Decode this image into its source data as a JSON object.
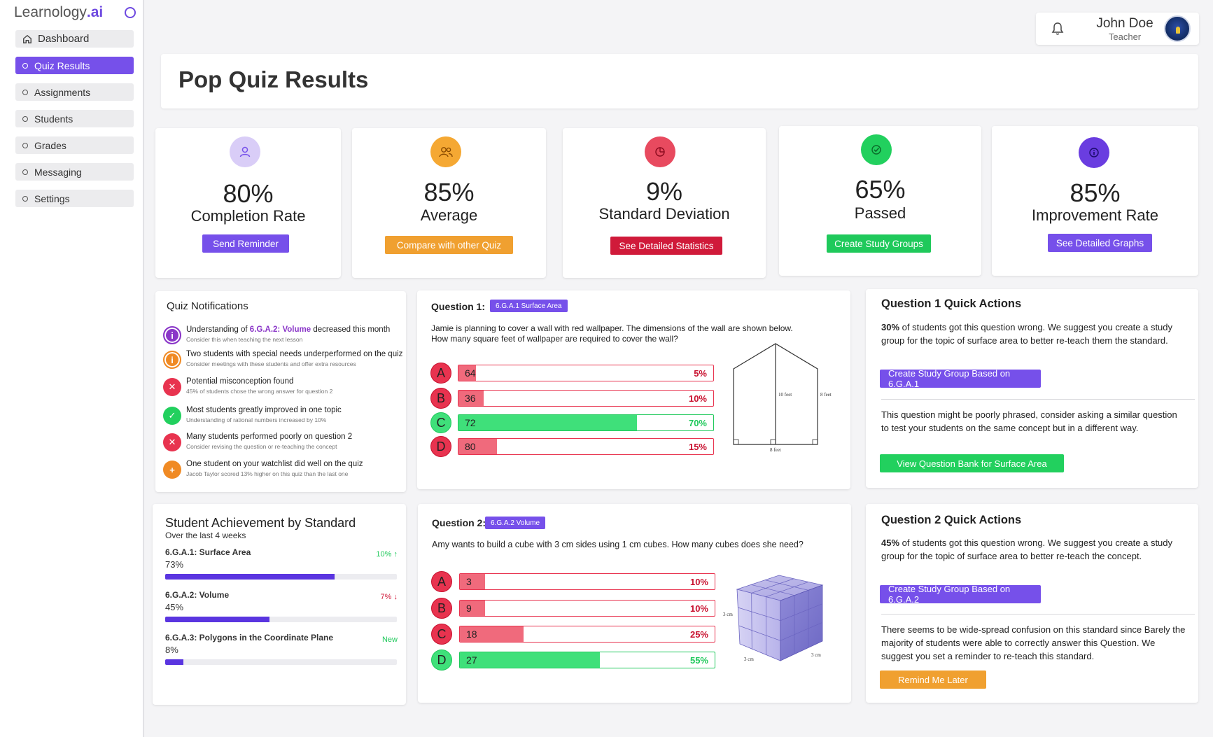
{
  "brand": {
    "name": "Learnology",
    "suffix": ".ai"
  },
  "sidebar": {
    "items": [
      {
        "label": "Dashboard"
      },
      {
        "label": "Quiz Results"
      },
      {
        "label": "Assignments"
      },
      {
        "label": "Students"
      },
      {
        "label": "Grades"
      },
      {
        "label": "Messaging"
      },
      {
        "label": "Settings"
      }
    ]
  },
  "user": {
    "name": "John Doe",
    "role": "Teacher"
  },
  "page": {
    "title": "Pop Quiz Results"
  },
  "stats": [
    {
      "value": "80%",
      "label": "Completion Rate",
      "button": "Send Reminder",
      "color": "#7650ea",
      "icon_bg": "#d9cdf7"
    },
    {
      "value": "85%",
      "label": "Average",
      "button": "Compare with other Quiz",
      "color": "#f0a030",
      "icon_bg": "#f5a833"
    },
    {
      "value": "9%",
      "label": "Standard Deviation",
      "button": "See Detailed Statistics",
      "color": "#d01a3a",
      "icon_bg": "#e84a5f"
    },
    {
      "value": "65%",
      "label": "Passed",
      "button": "Create Study Groups",
      "color": "#1fc95b",
      "icon_bg": "#22d05e"
    },
    {
      "value": "85%",
      "label": "Improvement Rate",
      "button": "See Detailed Graphs",
      "color": "#7650ea",
      "icon_bg": "#6a3de0"
    }
  ],
  "notifications": {
    "title": "Quiz Notifications",
    "items": [
      {
        "pre": "Understanding of ",
        "highlight": "6.G.A.2: Volume",
        "post": " decreased this month",
        "sub": "Consider this when teaching the next lesson",
        "icon": "info",
        "color": "#8a36c8"
      },
      {
        "pre": "Two students with special needs underperformed on the quiz",
        "highlight": "",
        "post": "",
        "sub": "Consider meetings with these students and offer extra resources",
        "icon": "info",
        "color": "#f08a24"
      },
      {
        "pre": "Potential misconception found",
        "highlight": "",
        "post": "",
        "sub": "45% of students chose the wrong answer for question 2",
        "icon": "x",
        "color": "#e8334f"
      },
      {
        "pre": "Most students greatly improved in one topic",
        "highlight": "",
        "post": "",
        "sub": "Understanding of rational numbers increased by 10%",
        "icon": "check",
        "color": "#22d05e"
      },
      {
        "pre": "Many students performed poorly on question 2",
        "highlight": "",
        "post": "",
        "sub": "Consider revising the question or re-teaching the concept",
        "icon": "x",
        "color": "#e8334f"
      },
      {
        "pre": "One student on your watchlist did well on the quiz",
        "highlight": "",
        "post": "",
        "sub": "Jacob Taylor scored 13% higher on this quiz than the last one",
        "icon": "plus",
        "color": "#f08a24"
      }
    ]
  },
  "question1": {
    "label": "Question 1:",
    "tag": "6.G.A.1 Surface Area",
    "text_line1": "Jamie is planning to cover a wall with red wallpaper. The dimensions of the wall are shown below.",
    "text_line2": "How many square feet of wallpaper are required to cover the wall?",
    "answers": [
      {
        "letter": "A",
        "count": "64",
        "pct": "5%",
        "value": 5,
        "correct": false
      },
      {
        "letter": "B",
        "count": "36",
        "pct": "10%",
        "value": 10,
        "correct": false
      },
      {
        "letter": "C",
        "count": "72",
        "pct": "70%",
        "value": 70,
        "correct": true
      },
      {
        "letter": "D",
        "count": "80",
        "pct": "15%",
        "value": 15,
        "correct": false
      }
    ],
    "figure": {
      "height_label": "10 feet",
      "side_label": "8 feet",
      "base_label": "8 feet"
    }
  },
  "question2": {
    "label": "Question 2:",
    "tag": "6.G.A.2 Volume",
    "text_line1": "Amy wants to build a cube with 3 cm sides using 1 cm cubes. How many cubes does she need?",
    "answers": [
      {
        "letter": "A",
        "count": "3",
        "pct": "10%",
        "value": 10,
        "correct": false
      },
      {
        "letter": "B",
        "count": "9",
        "pct": "10%",
        "value": 10,
        "correct": false
      },
      {
        "letter": "C",
        "count": "18",
        "pct": "25%",
        "value": 25,
        "correct": false
      },
      {
        "letter": "D",
        "count": "27",
        "pct": "55%",
        "value": 55,
        "correct": true
      }
    ],
    "figure": {
      "side_label": "3 cm"
    }
  },
  "qa1": {
    "title": "Question 1 Quick Actions",
    "p1_bold": "30%",
    "p1_rest": " of students got this question wrong. We suggest you create a study group for the topic of surface area to better re-teach them the standard.",
    "btn1": "Create Study Group Based on 6.G.A.1",
    "p2": "This question might be poorly phrased, consider asking a similar question to test your students on the same concept but in a different way.",
    "btn2": "View Question Bank for Surface Area"
  },
  "qa2": {
    "title": "Question 2 Quick Actions",
    "p1_bold": "45%",
    "p1_rest": " of students got this question wrong. We suggest you create a study group for the topic of surface area to better re-teach the concept.",
    "btn1": "Create Study Group Based on 6.G.A.2",
    "p2": "There seems to be wide-spread confusion on this standard since Barely the majority of students were able to correctly answer this Question. We suggest you set a reminder to re-teach this standard.",
    "btn2": "Remind Me Later"
  },
  "achievement": {
    "title": "Student Achievement by Standard",
    "subtitle": "Over the last 4 weeks",
    "items": [
      {
        "name": "6.G.A.1: Surface Area",
        "pct": "73%",
        "value": 73,
        "trend": "10%",
        "trend_dir": "up",
        "trend_color": "#1fc95b"
      },
      {
        "name": "6.G.A.2: Volume",
        "pct": "45%",
        "value": 45,
        "trend": "7%",
        "trend_dir": "down",
        "trend_color": "#d01a3a"
      },
      {
        "name": "6.G.A.3: Polygons in the Coordinate Plane",
        "pct": "8%",
        "value": 8,
        "trend": "New",
        "trend_dir": "",
        "trend_color": "#1fc95b"
      }
    ]
  },
  "colors": {
    "accent": "#7650ea",
    "correct": "#3fe07a",
    "correct_border": "#1fc95b",
    "wrong": "#f06a7c",
    "wrong_border": "#e8334f",
    "wrong_pct": "#c8102e",
    "correct_pct": "#1fc95b"
  }
}
